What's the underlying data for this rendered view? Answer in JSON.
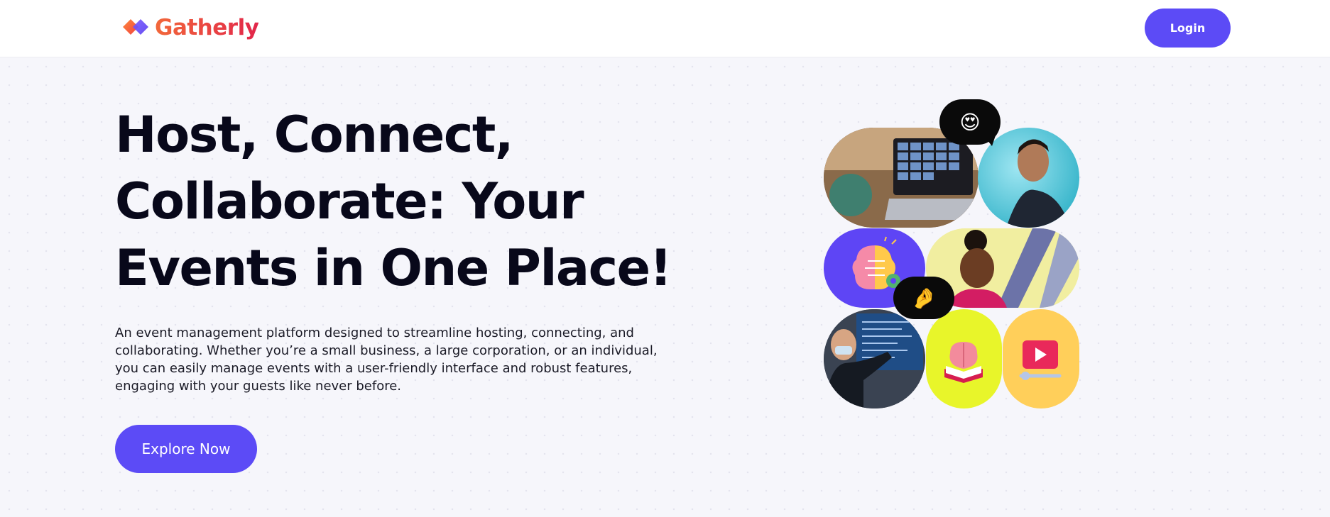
{
  "brand": {
    "name": "Gatherly"
  },
  "nav": {
    "login_label": "Login"
  },
  "hero": {
    "headline": "Host, Connect, Collaborate: Your Events in One Place!",
    "description": "An event management platform designed to streamline hosting, connecting, and collaborating. Whether you’re a small business, a large corporation, or an individual, you can easily manage events with a user-friendly interface and robust features, engaging with your guests like never before.",
    "cta_label": "Explore Now"
  },
  "collage": {
    "bubble_top": "😍",
    "bubble_mid": "🤌"
  },
  "colors": {
    "accent": "#5c4bf6",
    "brand_gradient_start": "#f2683a",
    "brand_gradient_end": "#e2264a",
    "headline": "#08081a"
  }
}
